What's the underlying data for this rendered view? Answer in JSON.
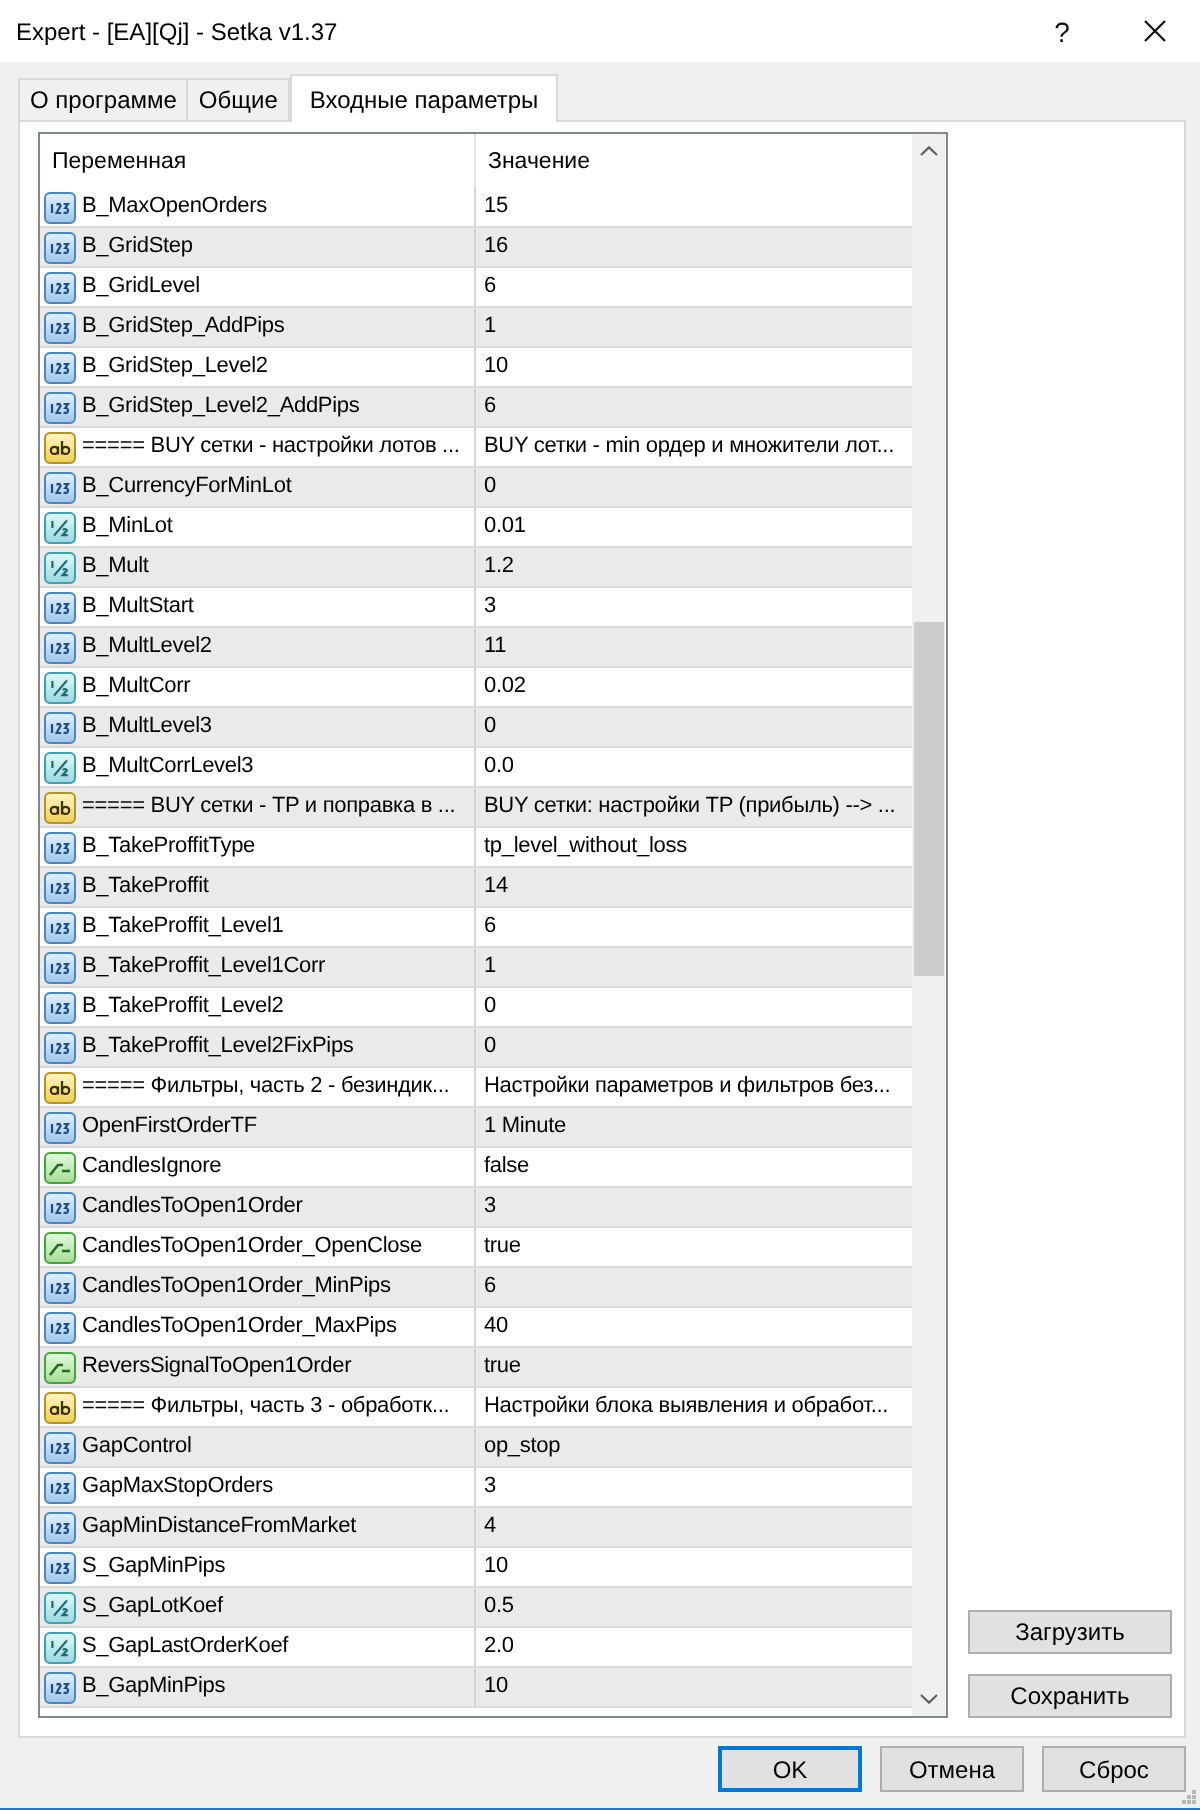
{
  "window": {
    "title": "Expert - [EA][Qj] - Setka v1.37",
    "help_button": "?"
  },
  "tabs": [
    {
      "label": "О программе",
      "selected": false
    },
    {
      "label": "Общие",
      "selected": false
    },
    {
      "label": "Входные параметры",
      "selected": true
    }
  ],
  "parameters": {
    "columns": [
      "Переменная",
      "Значение"
    ],
    "rows": [
      {
        "kind": "int",
        "name": "B_MaxOpenOrders",
        "value": "15"
      },
      {
        "kind": "int",
        "name": "B_GridStep",
        "value": "16"
      },
      {
        "kind": "int",
        "name": "B_GridLevel",
        "value": "6"
      },
      {
        "kind": "int",
        "name": "B_GridStep_AddPips",
        "value": "1"
      },
      {
        "kind": "int",
        "name": "B_GridStep_Level2",
        "value": "10"
      },
      {
        "kind": "int",
        "name": "B_GridStep_Level2_AddPips",
        "value": "6"
      },
      {
        "kind": "string",
        "name": "===== BUY сетки - настройки лотов ...",
        "value": "BUY сетки - min ордер и множители лот..."
      },
      {
        "kind": "int",
        "name": "B_CurrencyForMinLot",
        "value": "0"
      },
      {
        "kind": "double",
        "name": "B_MinLot",
        "value": "0.01"
      },
      {
        "kind": "double",
        "name": "B_Mult",
        "value": "1.2"
      },
      {
        "kind": "int",
        "name": "B_MultStart",
        "value": "3"
      },
      {
        "kind": "int",
        "name": "B_MultLevel2",
        "value": "11"
      },
      {
        "kind": "double",
        "name": "B_MultCorr",
        "value": "0.02"
      },
      {
        "kind": "int",
        "name": "B_MultLevel3",
        "value": "0"
      },
      {
        "kind": "double",
        "name": "B_MultCorrLevel3",
        "value": "0.0"
      },
      {
        "kind": "string",
        "name": "===== BUY сетки - TP и поправка в ...",
        "value": "BUY сетки: настройки TP (прибыль) --> ..."
      },
      {
        "kind": "int",
        "name": "B_TakeProffitType",
        "value": "tp_level_without_loss"
      },
      {
        "kind": "int",
        "name": "B_TakeProffit",
        "value": "14"
      },
      {
        "kind": "int",
        "name": "B_TakeProffit_Level1",
        "value": "6"
      },
      {
        "kind": "int",
        "name": "B_TakeProffit_Level1Corr",
        "value": "1"
      },
      {
        "kind": "int",
        "name": "B_TakeProffit_Level2",
        "value": "0"
      },
      {
        "kind": "int",
        "name": "B_TakeProffit_Level2FixPips",
        "value": "0"
      },
      {
        "kind": "string",
        "name": "===== Фильтры, часть 2 - безиндик...",
        "value": "Настройки параметров и фильтров без..."
      },
      {
        "kind": "int",
        "name": "OpenFirstOrderTF",
        "value": "1 Minute"
      },
      {
        "kind": "bool",
        "name": "CandlesIgnore",
        "value": "false"
      },
      {
        "kind": "int",
        "name": "CandlesToOpen1Order",
        "value": "3"
      },
      {
        "kind": "bool",
        "name": "CandlesToOpen1Order_OpenClose",
        "value": "true"
      },
      {
        "kind": "int",
        "name": "CandlesToOpen1Order_MinPips",
        "value": "6"
      },
      {
        "kind": "int",
        "name": "CandlesToOpen1Order_MaxPips",
        "value": "40"
      },
      {
        "kind": "bool",
        "name": "ReversSignalToOpen1Order",
        "value": "true"
      },
      {
        "kind": "string",
        "name": "===== Фильтры, часть 3 - обработк...",
        "value": "Настройки блока выявления и обработ..."
      },
      {
        "kind": "int",
        "name": "GapControl",
        "value": "op_stop"
      },
      {
        "kind": "int",
        "name": "GapMaxStopOrders",
        "value": "3"
      },
      {
        "kind": "int",
        "name": "GapMinDistanceFromMarket",
        "value": "4"
      },
      {
        "kind": "int",
        "name": "S_GapMinPips",
        "value": "10"
      },
      {
        "kind": "double",
        "name": "S_GapLotKoef",
        "value": "0.5"
      },
      {
        "kind": "double",
        "name": "S_GapLastOrderKoef",
        "value": "2.0"
      },
      {
        "kind": "int",
        "name": "B_GapMinPips",
        "value": "10"
      }
    ]
  },
  "side_buttons": [
    "Загрузить",
    "Сохранить"
  ],
  "buttons": [
    {
      "label": "OK",
      "default": true
    },
    {
      "label": "Отмена",
      "default": false
    },
    {
      "label": "Сброс",
      "default": false
    }
  ]
}
